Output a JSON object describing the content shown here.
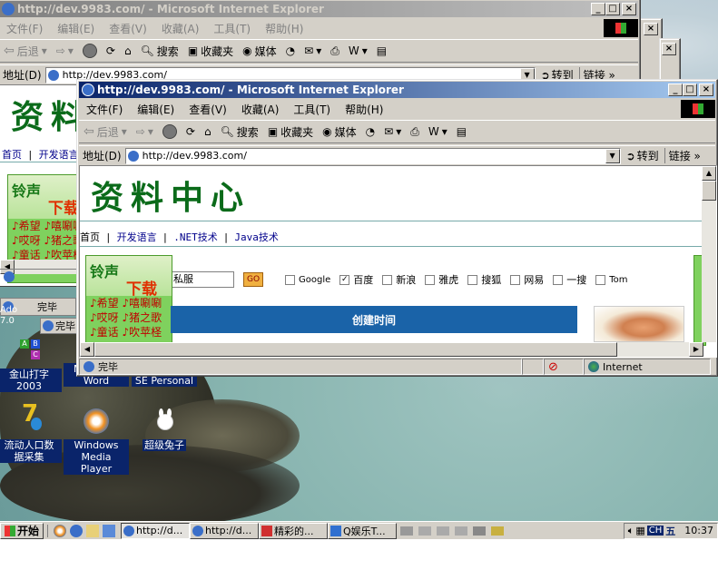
{
  "back_window": {
    "title": "http://dev.9983.com/ - Microsoft Internet Explorer",
    "menu": [
      "文件(F)",
      "编辑(E)",
      "查看(V)",
      "收藏(A)",
      "工具(T)",
      "帮助(H)"
    ],
    "toolbar": {
      "back": "后退",
      "search": "搜索",
      "favorites": "收藏夹",
      "media": "媒体"
    },
    "address_label": "地址(D)",
    "address_value": "http://dev.9983.com/",
    "go": "转到",
    "links": "链接",
    "logo": "资料",
    "nav": [
      "首页",
      "开发语言"
    ],
    "status_done": "完毕"
  },
  "front_window": {
    "title": "http://dev.9983.com/ - Microsoft Internet Explorer",
    "menu": [
      "文件(F)",
      "编辑(E)",
      "查看(V)",
      "收藏(A)",
      "工具(T)",
      "帮助(H)"
    ],
    "toolbar": {
      "back": "后退",
      "search": "搜索",
      "favorites": "收藏夹",
      "media": "媒体"
    },
    "address_label": "地址(D)",
    "address_value": "http://dev.9983.com/",
    "go": "转到",
    "links": "链接",
    "logo": "资料中心",
    "nav": [
      "首页",
      "开发语言",
      ".NET技术",
      "Java技术"
    ],
    "search_partial": "私服",
    "search_go": "GO",
    "engines": [
      {
        "label": "Google",
        "checked": false
      },
      {
        "label": "百度",
        "checked": true
      },
      {
        "label": "新浪",
        "checked": false
      },
      {
        "label": "雅虎",
        "checked": false
      },
      {
        "label": "搜狐",
        "checked": false
      },
      {
        "label": "网易",
        "checked": false
      },
      {
        "label": "一搜",
        "checked": false
      },
      {
        "label": "Tom",
        "checked": false
      }
    ],
    "table_header": "创建时间",
    "status_done": "完毕",
    "zone": "Internet"
  },
  "banner": {
    "title1": "铃声",
    "title2": "下载",
    "rows": [
      [
        "希望",
        "嘻唰唰"
      ],
      [
        "哎呀",
        "猪之歌"
      ],
      [
        "童话",
        "吹苹柽"
      ]
    ]
  },
  "minimized": [
    {
      "label": "Ado 7.0"
    },
    {
      "label": "完毕"
    },
    {
      "label": "完毕"
    }
  ],
  "desktop_icons": [
    {
      "label": "金山打字 2003"
    },
    {
      "label": "Microsoft Word"
    },
    {
      "label": "Ad-Aware SE Personal"
    },
    {
      "label": "流动人口数 据采集"
    },
    {
      "label": "Windows Media Player"
    },
    {
      "label": "超级兔子"
    }
  ],
  "taskbar": {
    "start": "开始",
    "tasks": [
      "http://d...",
      "http://d...",
      "精彩的...",
      "Q娱乐T..."
    ],
    "time": "10:37",
    "ime": "CH"
  },
  "colors": {
    "titlebar_active": "#0a246a",
    "logo_green": "#0b6b1a",
    "banner_green": "#7fd15e",
    "table_header_bg": "#1a63a8"
  }
}
